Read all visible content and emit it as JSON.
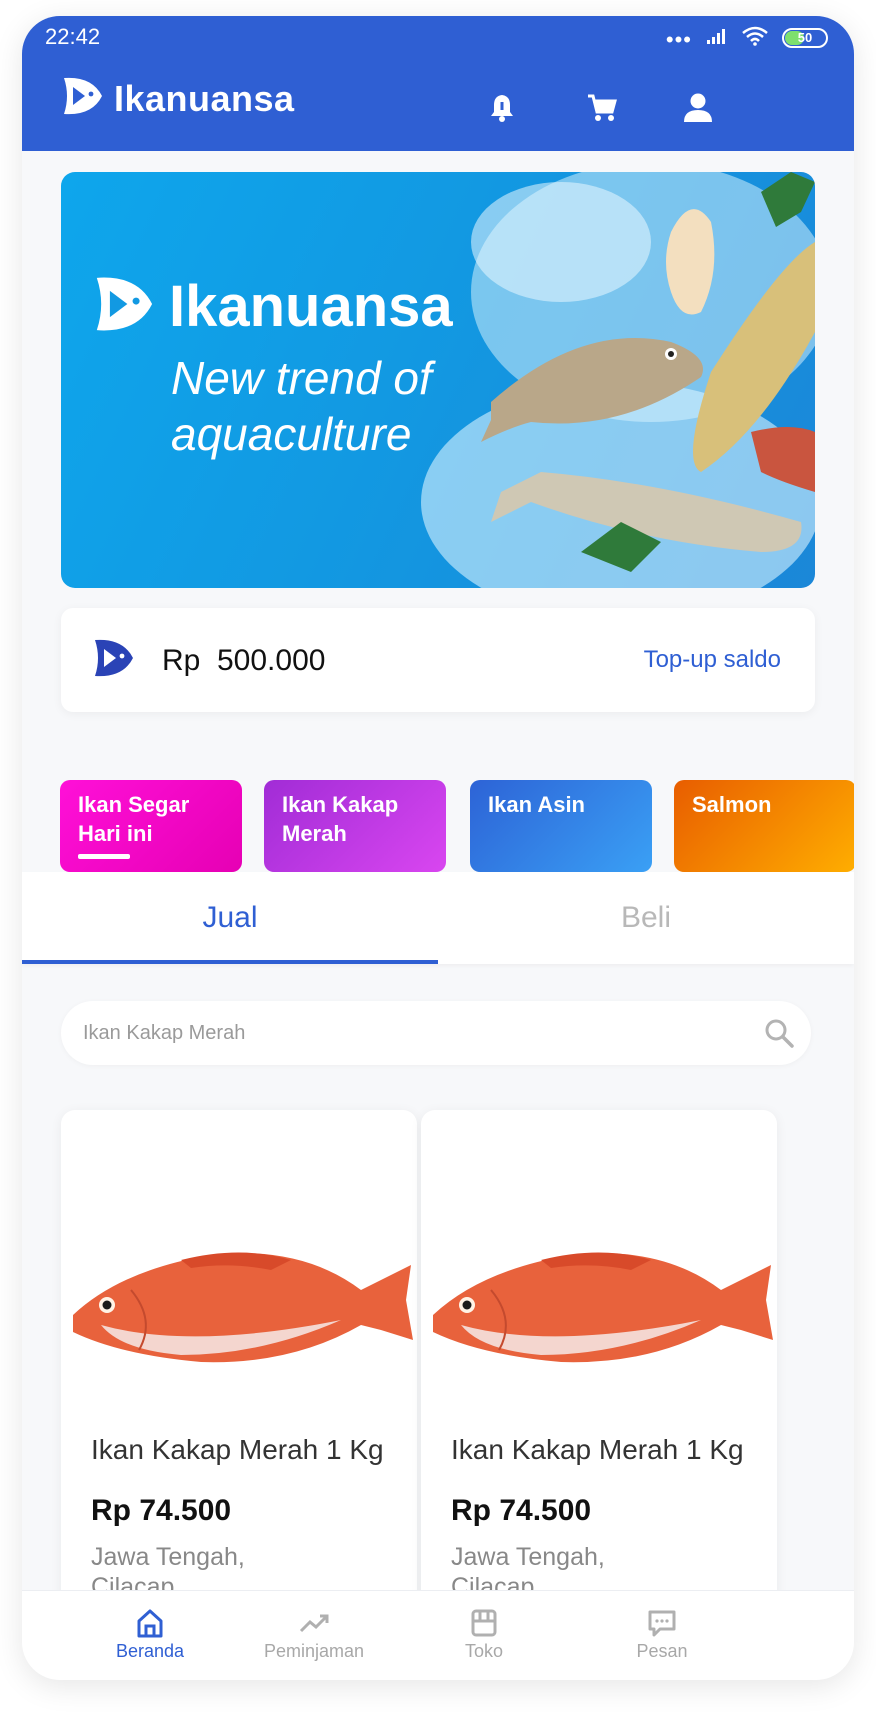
{
  "status_bar": {
    "time": "22:42",
    "battery": "50",
    "battery_level": 0.5
  },
  "header": {
    "brand": "Ikanuansa",
    "icons": [
      "bell-icon",
      "cart-icon",
      "user-icon"
    ]
  },
  "banner": {
    "brand": "Ikanuansa",
    "tagline_1": "New trend of",
    "tagline_2": "aquaculture"
  },
  "balance": {
    "currency": "Rp",
    "amount": "500.000",
    "topup_label": "Top-up saldo"
  },
  "categories": [
    {
      "line1": "Ikan Segar",
      "line2": "Hari ini"
    },
    {
      "line1": "Ikan Kakap",
      "line2": "Merah"
    },
    {
      "line1": "Ikan Asin",
      "line2": ""
    },
    {
      "line1": "Salmon",
      "line2": ""
    }
  ],
  "tabs": [
    {
      "label": "Jual"
    },
    {
      "label": "Beli"
    }
  ],
  "search": {
    "placeholder": "Ikan Kakap Merah"
  },
  "products": [
    {
      "title": "Ikan Kakap Merah 1 Kg",
      "price": "Rp 74.500",
      "loc1": "Jawa Tengah,",
      "loc2": "Cilacap"
    },
    {
      "title": "Ikan Kakap Merah 1 Kg",
      "price": "Rp 74.500",
      "loc1": "Jawa Tengah,",
      "loc2": "Cilacap"
    }
  ],
  "bottom_nav": [
    {
      "label": "Beranda",
      "icon": "home-icon"
    },
    {
      "label": "Peminjaman",
      "icon": "trending-up-icon"
    },
    {
      "label": "Toko",
      "icon": "store-icon"
    },
    {
      "label": "Pesan",
      "icon": "chat-icon"
    }
  ],
  "colors": {
    "primary": "#2f5fd3",
    "chip_pink": "#f000c8",
    "chip_purple": "#c23ae0",
    "chip_blue": "#2f7de6",
    "chip_orange": "#f07a00"
  }
}
